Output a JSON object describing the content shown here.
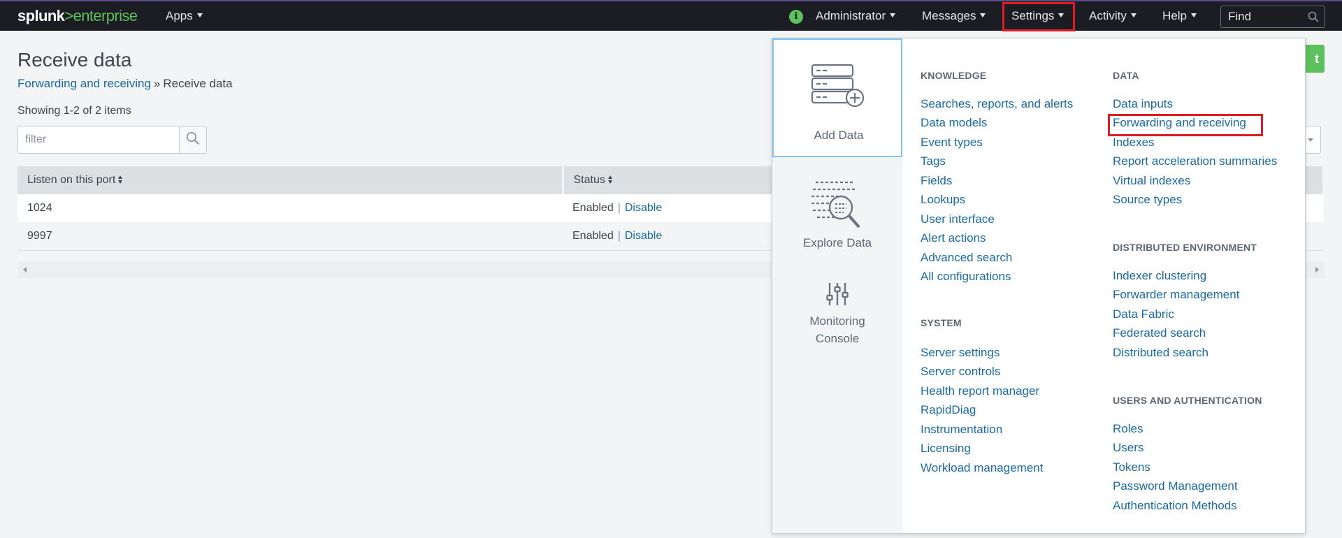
{
  "brand": {
    "splunk": "splunk",
    "arrow": ">",
    "product": "enterprise"
  },
  "topnav": {
    "apps": "Apps",
    "user": "Administrator",
    "messages": "Messages",
    "settings": "Settings",
    "activity": "Activity",
    "help": "Help",
    "find_placeholder": "Find",
    "info_glyph": "i"
  },
  "page": {
    "title": "Receive data",
    "breadcrumb": {
      "parent": "Forwarding and receiving",
      "separator": "»",
      "current": "Receive data"
    },
    "showing": "Showing 1-2 of 2 items",
    "filter_placeholder": "filter",
    "new_button_fragment": "t"
  },
  "table": {
    "columns": [
      "Listen on this port",
      "Status"
    ],
    "rows": [
      {
        "port": "1024",
        "status": "Enabled",
        "action": "Disable"
      },
      {
        "port": "9997",
        "status": "Enabled",
        "action": "Disable"
      }
    ],
    "separator": "|"
  },
  "settings_menu": {
    "tiles": {
      "add_data": "Add Data",
      "explore_data": "Explore Data",
      "monitoring_line1": "Monitoring",
      "monitoring_line2": "Console"
    },
    "knowledge": {
      "heading": "KNOWLEDGE",
      "items": [
        "Searches, reports, and alerts",
        "Data models",
        "Event types",
        "Tags",
        "Fields",
        "Lookups",
        "User interface",
        "Alert actions",
        "Advanced search",
        "All configurations"
      ]
    },
    "system": {
      "heading": "SYSTEM",
      "items": [
        "Server settings",
        "Server controls",
        "Health report manager",
        "RapidDiag",
        "Instrumentation",
        "Licensing",
        "Workload management"
      ]
    },
    "data": {
      "heading": "DATA",
      "items": [
        "Data inputs",
        "Forwarding and receiving",
        "Indexes",
        "Report acceleration summaries",
        "Virtual indexes",
        "Source types"
      ]
    },
    "distributed": {
      "heading": "DISTRIBUTED ENVIRONMENT",
      "items": [
        "Indexer clustering",
        "Forwarder management",
        "Data Fabric",
        "Federated search",
        "Distributed search"
      ]
    },
    "users": {
      "heading": "USERS AND AUTHENTICATION",
      "items": [
        "Roles",
        "Users",
        "Tokens",
        "Password Management",
        "Authentication Methods"
      ]
    }
  },
  "colors": {
    "accent_green": "#5cc05c",
    "link_blue": "#1a6aa3",
    "highlight_red": "#e01b24",
    "nav_bg": "#1b1d22"
  }
}
